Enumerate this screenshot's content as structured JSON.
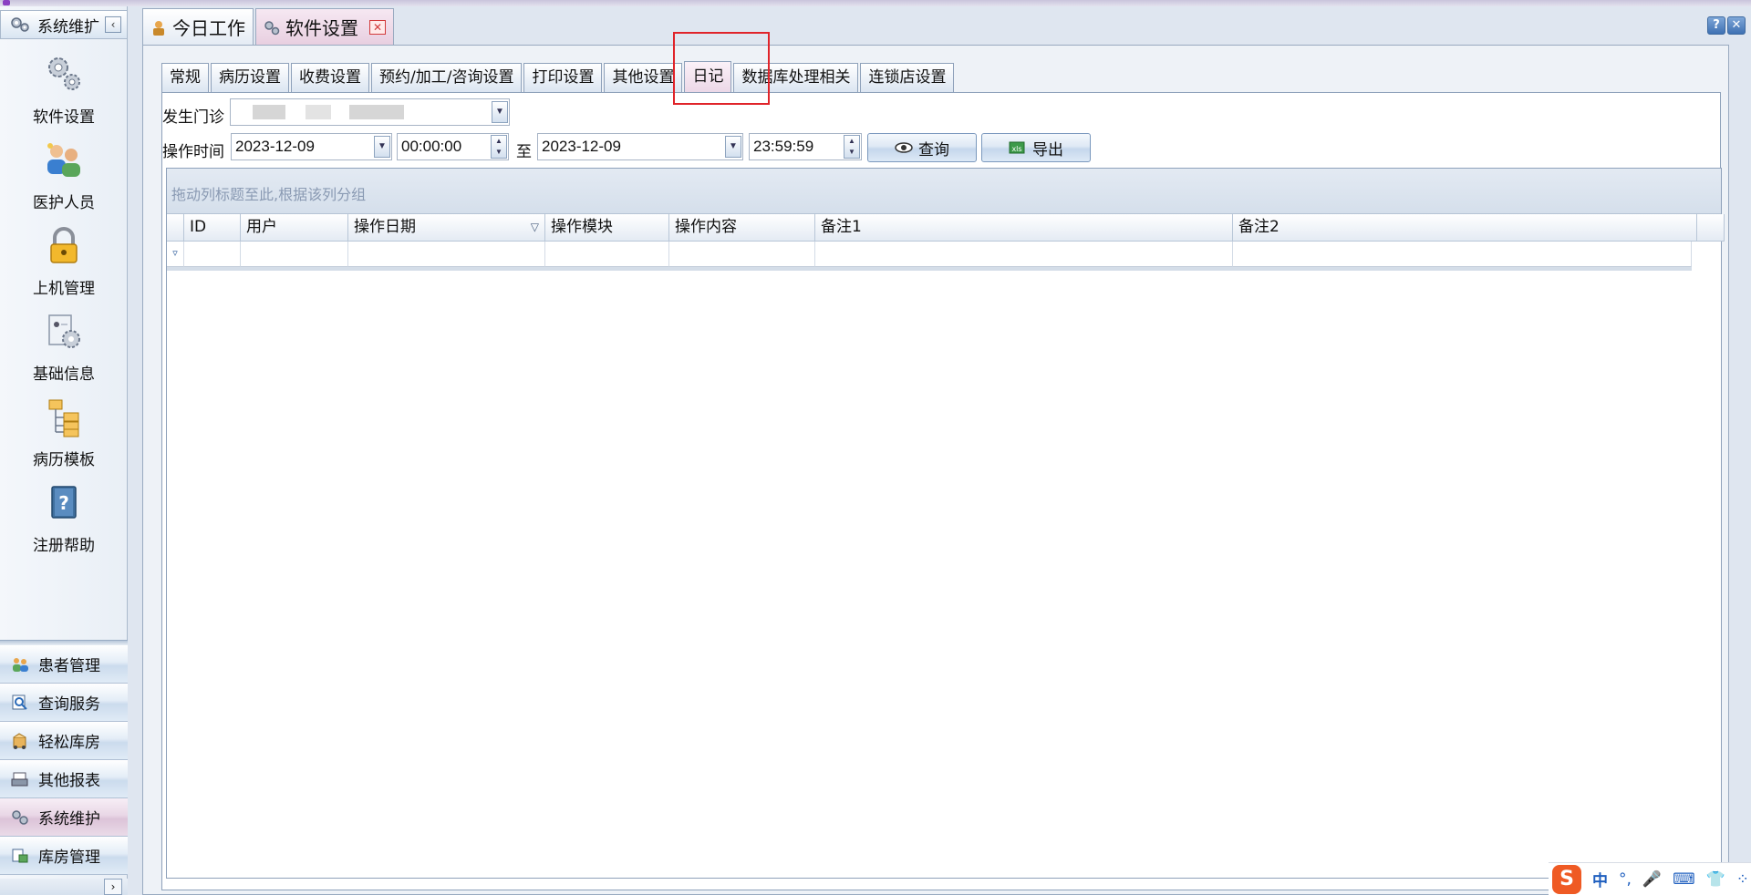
{
  "nav": {
    "header_title": "系统维扩",
    "collapse_glyph": "‹",
    "items": [
      {
        "label": "软件设置",
        "icon": "gears-icon"
      },
      {
        "label": "医护人员",
        "icon": "staff-icon"
      },
      {
        "label": "上机管理",
        "icon": "lock-icon"
      },
      {
        "label": "基础信息",
        "icon": "info-settings-icon"
      },
      {
        "label": "病历模板",
        "icon": "template-tree-icon"
      },
      {
        "label": "注册帮助",
        "icon": "help-book-icon"
      }
    ],
    "bottom_buttons": [
      {
        "label": "患者管理",
        "icon": "patients-icon"
      },
      {
        "label": "查询服务",
        "icon": "query-icon"
      },
      {
        "label": "轻松库房",
        "icon": "warehouse-icon"
      },
      {
        "label": "其他报表",
        "icon": "report-icon"
      },
      {
        "label": "系统维护",
        "icon": "gears-icon"
      },
      {
        "label": "库房管理",
        "icon": "inventory-icon"
      }
    ],
    "expand_glyph": "›"
  },
  "doc_tabs": [
    {
      "label": "今日工作",
      "icon": "worker-icon"
    },
    {
      "label": "软件设置",
      "icon": "gears-icon",
      "close": "✕"
    }
  ],
  "window_buttons": {
    "help": "?",
    "close": "✕"
  },
  "settings_tabs": [
    "常规",
    "病历设置",
    "收费设置",
    "预约/加工/咨询设置",
    "打印设置",
    "其他设置",
    "日记",
    "数据库处理相关",
    "连锁店设置"
  ],
  "filters": {
    "clinic_label": "发生门诊",
    "time_label": "操作时间",
    "start_date": "2023-12-09",
    "start_time": "00:00:00",
    "to_label": "至",
    "end_date": "2023-12-09",
    "end_time": "23:59:59",
    "query_button": "查询",
    "export_button": "导出"
  },
  "grid": {
    "group_hint": "拖动列标题至此,根据该列分组",
    "columns": [
      "ID",
      "用户",
      "操作日期",
      "操作模块",
      "操作内容",
      "备注1",
      "备注2"
    ],
    "sort_glyph": "▽",
    "filter_glyph": "▿"
  },
  "ime": {
    "logo": "S",
    "lang": "中",
    "punct": "°,",
    "mic": "🎤",
    "keyboard": "⌨",
    "skin": "👕",
    "menu": "⁘"
  },
  "colors": {
    "accent_pink": "#e8cfe0",
    "highlight_red": "#e0242a",
    "ime_orange": "#ef5a24"
  }
}
